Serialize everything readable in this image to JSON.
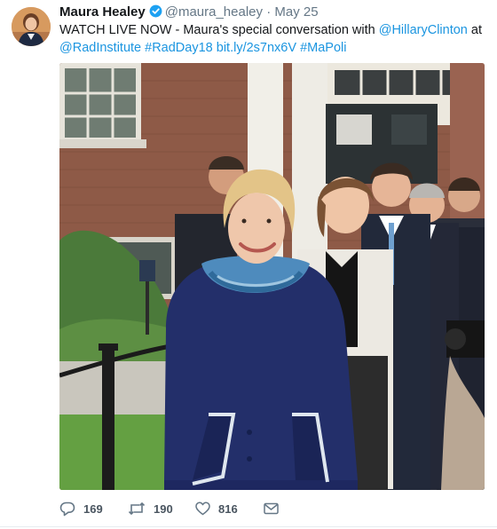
{
  "tweet": {
    "author_name": "Maura Healey",
    "handle": "@maura_healey",
    "separator": "·",
    "date": "May 25",
    "text_intro": "WATCH LIVE NOW - Maura's special conversation with ",
    "mention_1": "@HillaryClinton",
    "text_at": " at",
    "mention_2": "@RadInstitute",
    "hashtag_1": "#RadDay18",
    "short_link": "bit.ly/2s7nx6V",
    "hashtag_2": "#MaPoli",
    "counts": {
      "replies": "169",
      "retweets": "190",
      "likes": "816"
    }
  },
  "colors": {
    "link": "#1b95e0",
    "verified": "#1da1f2",
    "secondary_text": "#657786"
  },
  "icons": {
    "verified": "verified-badge-icon",
    "reply": "reply-icon",
    "retweet": "retweet-icon",
    "like": "heart-icon",
    "message": "envelope-icon"
  }
}
